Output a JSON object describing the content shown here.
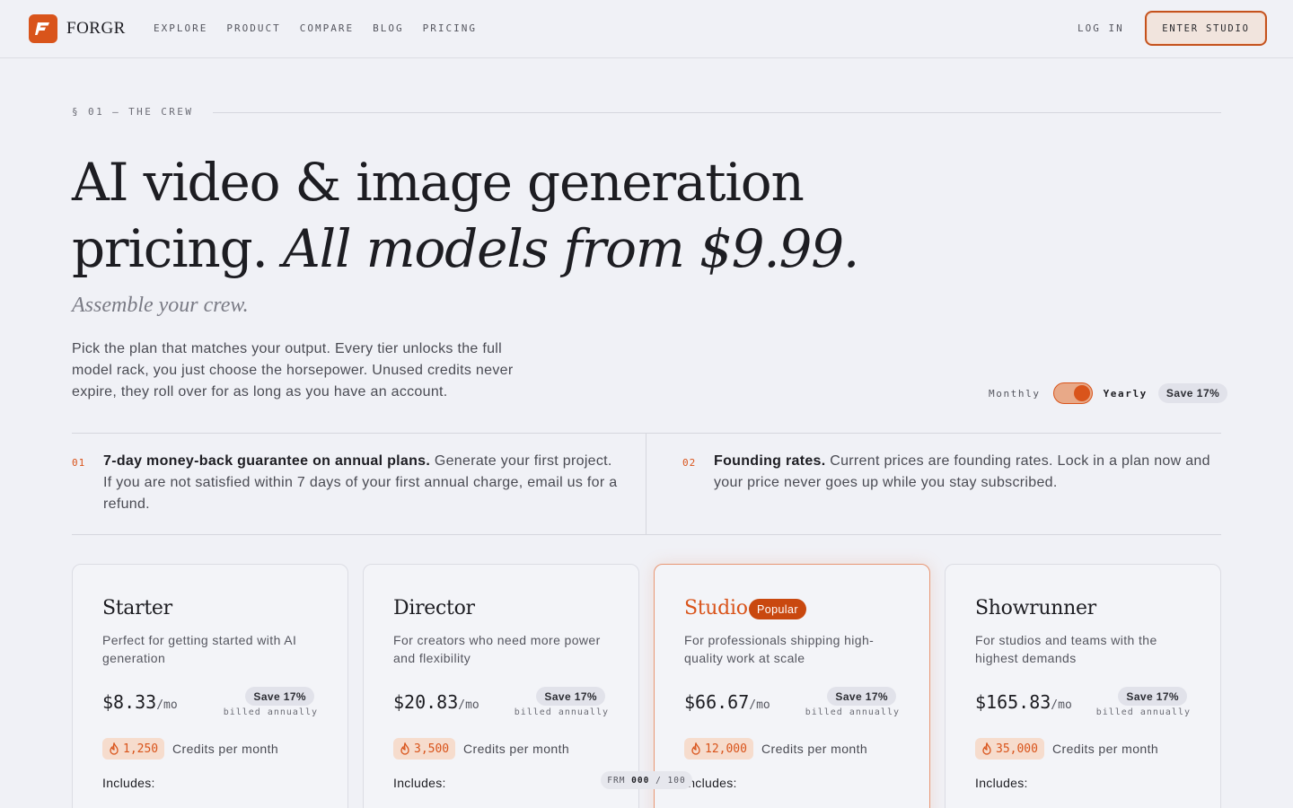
{
  "brand": {
    "name": "FORGR",
    "icon": "forgr-logo-icon",
    "accent": "#d9541b"
  },
  "nav": {
    "links": [
      "EXPLORE",
      "PRODUCT",
      "COMPARE",
      "BLOG",
      "PRICING"
    ],
    "login": "LOG IN",
    "cta": "ENTER STUDIO"
  },
  "section": {
    "label": "§ 01 — THE CREW"
  },
  "hero": {
    "title_line1": "AI video & image generation",
    "title_line2_plain": "pricing. ",
    "title_line2_italic": "All models from $9.99.",
    "tagline": "Assemble your crew.",
    "intro": "Pick the plan that matches your output. Every tier unlocks the full model rack, you just choose the horsepower. Unused credits never expire, they roll over for as long as you have an account."
  },
  "billing": {
    "monthly": "Monthly",
    "yearly": "Yearly",
    "save": "Save 17%",
    "selected": "Yearly"
  },
  "notes": [
    {
      "num": "01",
      "title": "7-day money-back guarantee on annual plans.",
      "body": " Generate your first project. If you are not satisfied within 7 days of your first annual charge, email us for a refund."
    },
    {
      "num": "02",
      "title": "Founding rates.",
      "body": " Current prices are founding rates. Lock in a plan now and your price never goes up while you stay subscribed."
    }
  ],
  "plans": [
    {
      "name": "Starter",
      "desc": "Perfect for getting started with AI generation",
      "price": "$8.33",
      "per": "/mo",
      "save": "Save 17%",
      "billed": "billed annually",
      "credits": "1,250",
      "credits_label": "Credits per month",
      "includes": "Includes:"
    },
    {
      "name": "Director",
      "desc": "For creators who need more power and flexibility",
      "price": "$20.83",
      "per": "/mo",
      "save": "Save 17%",
      "billed": "billed annually",
      "credits": "3,500",
      "credits_label": "Credits per month",
      "includes": "Includes:"
    },
    {
      "name": "Studio",
      "badge": "Popular",
      "desc": "For professionals shipping high-quality work at scale",
      "price": "$66.67",
      "per": "/mo",
      "save": "Save 17%",
      "billed": "billed annually",
      "credits": "12,000",
      "credits_label": "Credits per month",
      "includes": "Includes:"
    },
    {
      "name": "Showrunner",
      "desc": "For studios and teams with the highest demands",
      "price": "$165.83",
      "per": "/mo",
      "save": "Save 17%",
      "billed": "billed annually",
      "credits": "35,000",
      "credits_label": "Credits per month",
      "includes": "Includes:"
    }
  ],
  "fps_overlay": {
    "label": "FRM",
    "value": "000",
    "sep": "/",
    "total": "100"
  }
}
